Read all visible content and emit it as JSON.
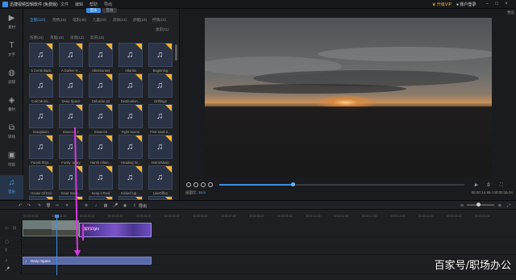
{
  "app": {
    "title": "迅捷视频剪辑软件 (免费版)",
    "menu": [
      "文件",
      "编辑",
      "帮助",
      "导出"
    ],
    "upgrade_label": "升级VIP",
    "account_label": "账户登录"
  },
  "leftnav": [
    {
      "label": "素材",
      "icon": "media-icon"
    },
    {
      "label": "文字",
      "icon": "text-icon"
    },
    {
      "label": "滤镜",
      "icon": "filter-icon"
    },
    {
      "label": "叠附",
      "icon": "overlay-icon"
    },
    {
      "label": "转场",
      "icon": "transition-icon"
    },
    {
      "label": "动画",
      "icon": "animation-icon"
    },
    {
      "label": "音乐",
      "icon": "music-icon",
      "active": true
    }
  ],
  "library": {
    "tabs": [
      "音乐",
      "音效"
    ],
    "filters_row1": [
      "全部(110)",
      "悠扬(16)",
      "电影(48)",
      "儿童(18)",
      "欢快(14)",
      "舒缓(18)",
      "抒情(15)",
      "激昂(11)"
    ],
    "filters_row2": [
      "伤感(16)",
      "英雄(18)",
      "诙谐(13)",
      "欢庆(18)"
    ],
    "tiles": [
      "5 Cents Back",
      "A Darker H...",
      "AllenSunset",
      "Atlantis",
      "Beginning",
      "Cold Morni...",
      "Deep Space",
      "Delusion 32",
      "Destination...",
      "Drifting2",
      "Ectoplasm",
      "Essence 2",
      "Essence",
      "Fight Scene",
      "First Noel-2...",
      "Forest Rhyt...",
      "Funky Junky",
      "Harsh Allam...",
      "Heading W...",
      "HorrorMusic",
      "House Of Evil",
      "Inner Stom...",
      "Keep it Real",
      "Kicked Up ...",
      "LineOffice",
      "",
      "",
      "",
      "",
      ""
    ]
  },
  "preview": {
    "title": "预览",
    "timecode_current": "00:00:14.85",
    "timecode_total": "00:00:15.04",
    "aspect_label": "16:9",
    "aspect_prefix": "画面比:",
    "progress": 0.3
  },
  "timeline": {
    "export_label": "导出",
    "ticks": [
      "00:00:00.00",
      "00:00:01.00",
      "00:00:02.00",
      "00:00:03.00",
      "00:00:04.00",
      "00:00:05.00",
      "00:00:06.00",
      "00:00:07.00",
      "00:00:08.00",
      "00:00:09.00",
      "00:00:10.00",
      "00:00:11.00",
      "00:00:12.00",
      "00:00:13.00",
      "00:00:14.00",
      "00:00:15.00",
      "00:00:16.00"
    ],
    "effect_clip_label": "素材Light",
    "audio_clip_label": "Deep Space"
  },
  "watermark": "百家号/职场办公",
  "colors": {
    "accent": "#3a8ee6",
    "badge": "#f0b236",
    "arrow": "#d63adf"
  }
}
